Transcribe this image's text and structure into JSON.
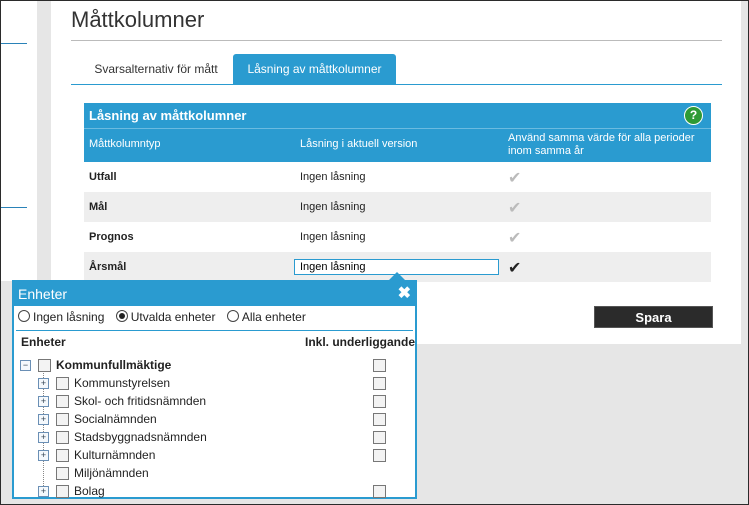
{
  "page": {
    "title": "Måttkolumner"
  },
  "tabs": [
    {
      "label": "Svarsalternativ för mått",
      "active": false
    },
    {
      "label": "Låsning av måttkolumner",
      "active": true
    }
  ],
  "panel": {
    "title": "Låsning av måttkolumner",
    "help_icon": "question-icon",
    "columns": [
      "Måttkolumntyp",
      "Låsning i aktuell version",
      "Använd samma värde för alla perioder inom samma år"
    ],
    "rows": [
      {
        "type": "Utfall",
        "locking": "Ingen låsning",
        "same_value": true,
        "active": false
      },
      {
        "type": "Mål",
        "locking": "Ingen låsning",
        "same_value": true,
        "active": false
      },
      {
        "type": "Prognos",
        "locking": "Ingen låsning",
        "same_value": true,
        "active": false
      },
      {
        "type": "Årsmål",
        "locking": "Ingen låsning",
        "same_value": true,
        "active": true
      }
    ]
  },
  "save_label": "Spara",
  "popup": {
    "title": "Enheter",
    "close_icon": "close-icon",
    "radio_options": [
      {
        "label": "Ingen låsning",
        "selected": false
      },
      {
        "label": "Utvalda enheter",
        "selected": true
      },
      {
        "label": "Alla enheter",
        "selected": false
      }
    ],
    "col_units": "Enheter",
    "col_incl": "Inkl. underliggande",
    "tree_root": "Kommunfullmäktige",
    "tree_children": [
      "Kommunstyrelsen",
      "Skol- och fritidsnämnden",
      "Socialnämnden",
      "Stadsbyggnadsnämnden",
      "Kulturnämnden",
      "Miljönämnden",
      "Bolag"
    ]
  },
  "colors": {
    "accent": "#2a9bd0",
    "help": "#2e9a35",
    "save_bg": "#2b2b2b"
  }
}
